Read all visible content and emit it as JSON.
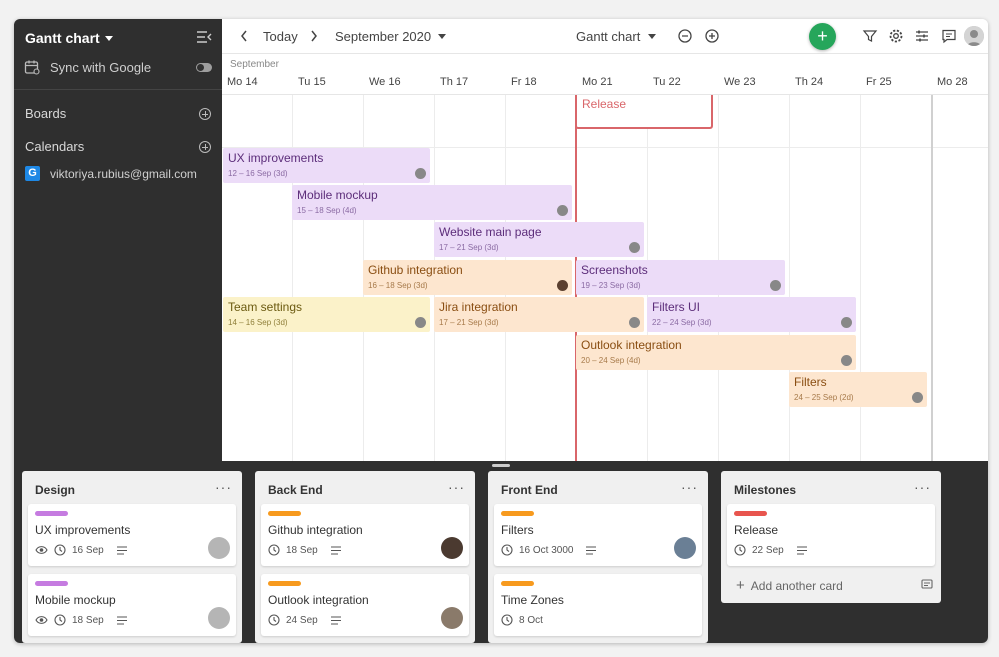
{
  "sidebar": {
    "title": "Gantt chart",
    "sync_label": "Sync with Google",
    "boards_label": "Boards",
    "calendars_label": "Calendars",
    "calendar_email": "viktoriya.rubius@gmail.com",
    "calendar_icon_letter": "G"
  },
  "toolbar": {
    "today_label": "Today",
    "period_label": "September 2020",
    "view_label": "Gantt chart",
    "add_label": "+"
  },
  "timeline": {
    "month_label": "September",
    "days": [
      "Mo 14",
      "Tu 15",
      "We 16",
      "Th 17",
      "Fr 18",
      "Mo 21",
      "Tu 22",
      "We 23",
      "Th 24",
      "Fr 25",
      "Mo 28"
    ]
  },
  "milestone": {
    "label": "Release"
  },
  "tasks": [
    {
      "title": "UX improvements",
      "dates": "12 – 16 Sep (3d)",
      "color": "purple"
    },
    {
      "title": "Mobile mockup",
      "dates": "15 – 18 Sep (4d)",
      "color": "purple"
    },
    {
      "title": "Website main page",
      "dates": "17 – 21 Sep (3d)",
      "color": "purple"
    },
    {
      "title": "Github integration",
      "dates": "16 – 18 Sep (3d)",
      "color": "orange"
    },
    {
      "title": "Screenshots",
      "dates": "19 – 23 Sep (3d)",
      "color": "purple"
    },
    {
      "title": "Team settings",
      "dates": "14 – 16 Sep (3d)",
      "color": "yellow"
    },
    {
      "title": "Jira integration",
      "dates": "17 – 21 Sep (3d)",
      "color": "orange"
    },
    {
      "title": "Filters UI",
      "dates": "22 – 24 Sep (3d)",
      "color": "purple"
    },
    {
      "title": "Outlook integration",
      "dates": "20 – 24 Sep (4d)",
      "color": "orange"
    },
    {
      "title": "Filters",
      "dates": "24 – 25 Sep (2d)",
      "color": "orange"
    }
  ],
  "boards": [
    {
      "title": "Design",
      "more": "···",
      "cards": [
        {
          "title": "UX improvements",
          "date": "16 Sep",
          "tag_color": "#c57be0",
          "watch": true
        },
        {
          "title": "Mobile mockup",
          "date": "18 Sep",
          "tag_color": "#c57be0",
          "watch": true
        }
      ]
    },
    {
      "title": "Back End",
      "more": "···",
      "cards": [
        {
          "title": "Github integration",
          "date": "18 Sep",
          "tag_color": "#f79a1e",
          "watch": false
        },
        {
          "title": "Outlook integration",
          "date": "24 Sep",
          "tag_color": "#f79a1e",
          "watch": false
        }
      ]
    },
    {
      "title": "Front End",
      "more": "···",
      "cards": [
        {
          "title": "Filters",
          "date": "16 Oct 3000",
          "tag_color": "#f79a1e",
          "watch": false
        },
        {
          "title": "Time Zones",
          "date": "8 Oct",
          "tag_color": "#f79a1e",
          "watch": false
        }
      ]
    },
    {
      "title": "Milestones",
      "more": "···",
      "cards": [
        {
          "title": "Release",
          "date": "22 Sep",
          "tag_color": "#e8554e",
          "watch": false
        }
      ],
      "add_card_label": "Add another card"
    }
  ],
  "colors": {
    "today_line": "#d9666a",
    "add_button": "#26a65b",
    "sidebar_bg": "#2f2f2f"
  }
}
